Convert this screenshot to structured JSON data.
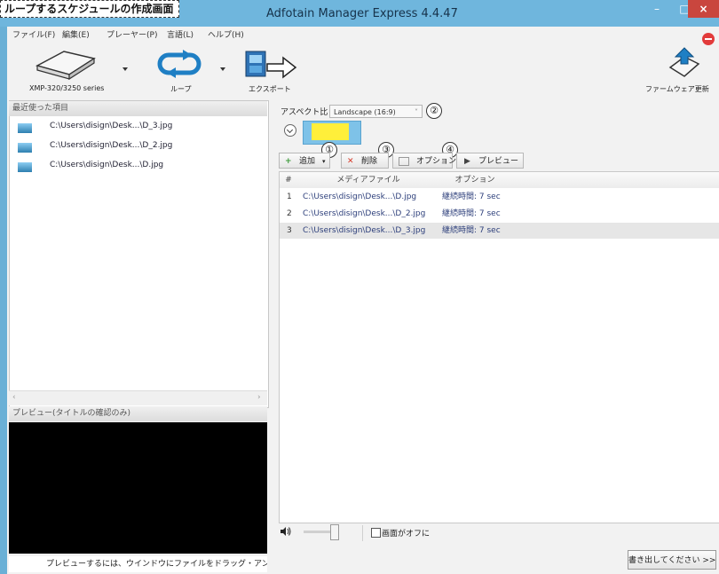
{
  "caption_banner": "ループするスケジュールの作成画面",
  "window": {
    "title": "Adfotain Manager Express 4.4.47",
    "min_glyph": "–",
    "max_glyph": "□",
    "close_glyph": "×"
  },
  "menu": [
    "ファイル(F)",
    "編集(E)",
    "プレーヤー(P)",
    "言語(L)",
    "ヘルプ(H)"
  ],
  "toolbar": {
    "device_label": "XMP-320/3250 series",
    "loop_label": "ループ",
    "export_label": "エクスポート",
    "firmware_label": "ファームウェア更新"
  },
  "recent": {
    "header": "最近使った項目",
    "items": [
      "C:\\Users\\disign\\Desk...\\D_3.jpg",
      "C:\\Users\\disign\\Desk...\\D_2.jpg",
      "C:\\Users\\disign\\Desk...\\D.jpg"
    ]
  },
  "preview": {
    "header": "プレビュー(タイトルの確認のみ)",
    "hint": "プレビューするには、ウインドウにファイルをドラッグ・アンド・ドロ"
  },
  "aspect": {
    "label": "アスペクト比",
    "value": "Landscape (16:9)"
  },
  "badges": [
    "①",
    "②",
    "③",
    "④"
  ],
  "list_toolbar": {
    "add": "追加",
    "delete": "削除",
    "options": "オプション",
    "preview": "プレビュー"
  },
  "table": {
    "columns": [
      "#",
      "メディアファイル",
      "オプション"
    ],
    "rows": [
      {
        "num": "1",
        "file": "C:\\Users\\disign\\Desk...\\D.jpg",
        "option": "継続時間: 7 sec"
      },
      {
        "num": "2",
        "file": "C:\\Users\\disign\\Desk...\\D_2.jpg",
        "option": "継続時間: 7 sec"
      },
      {
        "num": "3",
        "file": "C:\\Users\\disign\\Desk...\\D_3.jpg",
        "option": "継続時間: 7 sec"
      }
    ],
    "selected_row": 3
  },
  "bottom": {
    "screen_off_label": "画面がオフに",
    "write_button": "書き出してください >>"
  },
  "colors": {
    "titlebar": "#6fb6dd",
    "close": "#c9463e",
    "thumb_yellow": "#ffef3a",
    "delete_x": "#d63a2a",
    "add_plus": "#3d9a3a"
  }
}
